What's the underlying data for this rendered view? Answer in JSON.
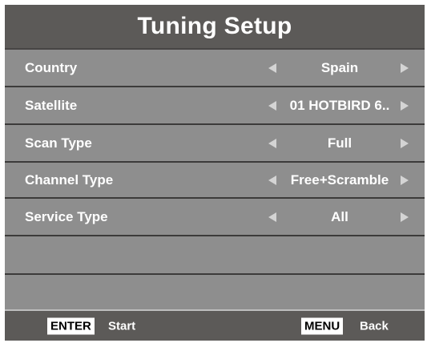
{
  "header": {
    "title": "Tuning Setup"
  },
  "settings": [
    {
      "label": "Country",
      "value": "Spain"
    },
    {
      "label": "Satellite",
      "value": "01 HOTBIRD 6.."
    },
    {
      "label": "Scan Type",
      "value": "Full"
    },
    {
      "label": "Channel Type",
      "value": "Free+Scramble"
    },
    {
      "label": "Service Type",
      "value": "All"
    }
  ],
  "footer": {
    "enter_key": "ENTER",
    "enter_action": "Start",
    "menu_key": "MENU",
    "menu_action": "Back"
  },
  "icons": {
    "left": "arrow-left-icon",
    "right": "arrow-right-icon"
  },
  "colors": {
    "title_bar": "#5c5a58",
    "panel": "#8e8e8e",
    "separator": "#3c3b3a",
    "text": "#ffffff",
    "arrow": "#d4d4d4"
  }
}
